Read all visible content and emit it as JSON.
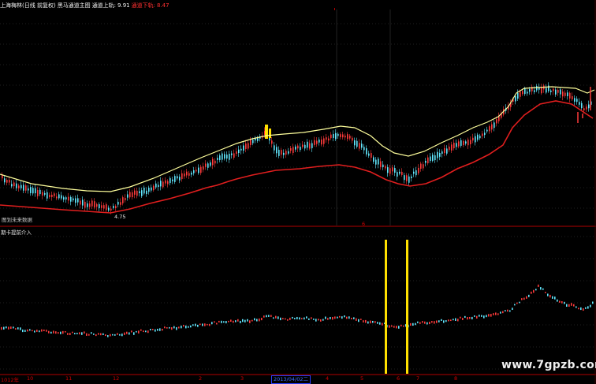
{
  "header": {
    "title": "上海梅林(日线 前复权)",
    "indicator": "黑马通道主图",
    "upper_label": "通道上轨:",
    "upper_value": "9.91",
    "lower_label": "通道下轨:",
    "lower_value": "8.47"
  },
  "main_panel": {
    "low_price_label": "4.75",
    "secondary_caption": "图划未来数据",
    "cursor_marker": "6"
  },
  "sub_panel": {
    "title": "期卡提前介入"
  },
  "time_axis": {
    "labels": [
      "1012年",
      "10",
      "11",
      "12",
      "2",
      "3",
      "4",
      "5",
      "6",
      "7",
      "8"
    ],
    "current_date": "2013/04/02二"
  },
  "watermark": "www.7gpzb.com",
  "colors": {
    "up_candle": "#ff3b3b",
    "down_candle": "#62e8ff",
    "upper_band": "#ffff9c",
    "lower_band": "#e01e1e",
    "signal_bar": "#ffe000",
    "panel_border": "#b00000"
  }
}
